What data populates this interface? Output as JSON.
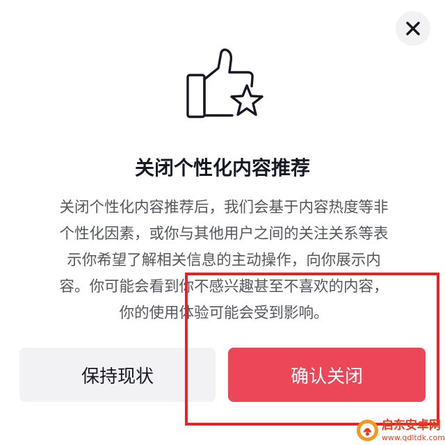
{
  "dialog": {
    "title": "关闭个性化内容推荐",
    "body_lines": [
      "关闭个性化内容推荐后，我们会基于内容热度等非",
      "个性化因素，或你与其他用户之间的关注关系等表",
      "示你希望了解相关信息的主动操作，向你展示内",
      "容。你可能会看到你不感兴趣甚至不喜欢的内容，",
      "你的使用体验可能会受到影响。"
    ],
    "keep_button_label": "保持现状",
    "confirm_button_label": "确认关闭",
    "close_icon": "close-icon",
    "hero_icon": "thumbs-up-star-icon"
  },
  "watermark": {
    "name": "启东安卓网",
    "url": "www.qdltdk.com"
  },
  "colors": {
    "confirm": "#ec4659",
    "keep": "#f2f2f4",
    "annotation": "#e3242b",
    "title_text": "#161823",
    "body_text": "#55575e"
  }
}
